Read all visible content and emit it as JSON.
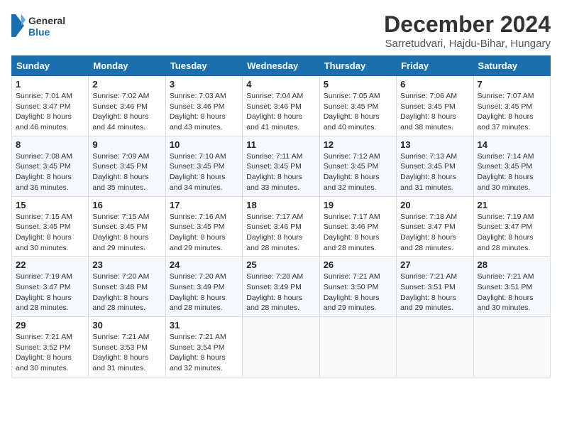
{
  "header": {
    "logo_general": "General",
    "logo_blue": "Blue",
    "month_title": "December 2024",
    "subtitle": "Sarretudvari, Hajdu-Bihar, Hungary"
  },
  "calendar": {
    "headers": [
      "Sunday",
      "Monday",
      "Tuesday",
      "Wednesday",
      "Thursday",
      "Friday",
      "Saturday"
    ],
    "weeks": [
      [
        null,
        null,
        null,
        null,
        null,
        null,
        null
      ]
    ],
    "days": {
      "1": {
        "sunrise": "7:01 AM",
        "sunset": "3:47 PM",
        "daylight": "8 hours and 46 minutes."
      },
      "2": {
        "sunrise": "7:02 AM",
        "sunset": "3:46 PM",
        "daylight": "8 hours and 44 minutes."
      },
      "3": {
        "sunrise": "7:03 AM",
        "sunset": "3:46 PM",
        "daylight": "8 hours and 43 minutes."
      },
      "4": {
        "sunrise": "7:04 AM",
        "sunset": "3:46 PM",
        "daylight": "8 hours and 41 minutes."
      },
      "5": {
        "sunrise": "7:05 AM",
        "sunset": "3:45 PM",
        "daylight": "8 hours and 40 minutes."
      },
      "6": {
        "sunrise": "7:06 AM",
        "sunset": "3:45 PM",
        "daylight": "8 hours and 38 minutes."
      },
      "7": {
        "sunrise": "7:07 AM",
        "sunset": "3:45 PM",
        "daylight": "8 hours and 37 minutes."
      },
      "8": {
        "sunrise": "7:08 AM",
        "sunset": "3:45 PM",
        "daylight": "8 hours and 36 minutes."
      },
      "9": {
        "sunrise": "7:09 AM",
        "sunset": "3:45 PM",
        "daylight": "8 hours and 35 minutes."
      },
      "10": {
        "sunrise": "7:10 AM",
        "sunset": "3:45 PM",
        "daylight": "8 hours and 34 minutes."
      },
      "11": {
        "sunrise": "7:11 AM",
        "sunset": "3:45 PM",
        "daylight": "8 hours and 33 minutes."
      },
      "12": {
        "sunrise": "7:12 AM",
        "sunset": "3:45 PM",
        "daylight": "8 hours and 32 minutes."
      },
      "13": {
        "sunrise": "7:13 AM",
        "sunset": "3:45 PM",
        "daylight": "8 hours and 31 minutes."
      },
      "14": {
        "sunrise": "7:14 AM",
        "sunset": "3:45 PM",
        "daylight": "8 hours and 30 minutes."
      },
      "15": {
        "sunrise": "7:15 AM",
        "sunset": "3:45 PM",
        "daylight": "8 hours and 30 minutes."
      },
      "16": {
        "sunrise": "7:15 AM",
        "sunset": "3:45 PM",
        "daylight": "8 hours and 29 minutes."
      },
      "17": {
        "sunrise": "7:16 AM",
        "sunset": "3:45 PM",
        "daylight": "8 hours and 29 minutes."
      },
      "18": {
        "sunrise": "7:17 AM",
        "sunset": "3:46 PM",
        "daylight": "8 hours and 28 minutes."
      },
      "19": {
        "sunrise": "7:17 AM",
        "sunset": "3:46 PM",
        "daylight": "8 hours and 28 minutes."
      },
      "20": {
        "sunrise": "7:18 AM",
        "sunset": "3:47 PM",
        "daylight": "8 hours and 28 minutes."
      },
      "21": {
        "sunrise": "7:19 AM",
        "sunset": "3:47 PM",
        "daylight": "8 hours and 28 minutes."
      },
      "22": {
        "sunrise": "7:19 AM",
        "sunset": "3:47 PM",
        "daylight": "8 hours and 28 minutes."
      },
      "23": {
        "sunrise": "7:20 AM",
        "sunset": "3:48 PM",
        "daylight": "8 hours and 28 minutes."
      },
      "24": {
        "sunrise": "7:20 AM",
        "sunset": "3:49 PM",
        "daylight": "8 hours and 28 minutes."
      },
      "25": {
        "sunrise": "7:20 AM",
        "sunset": "3:49 PM",
        "daylight": "8 hours and 28 minutes."
      },
      "26": {
        "sunrise": "7:21 AM",
        "sunset": "3:50 PM",
        "daylight": "8 hours and 29 minutes."
      },
      "27": {
        "sunrise": "7:21 AM",
        "sunset": "3:51 PM",
        "daylight": "8 hours and 29 minutes."
      },
      "28": {
        "sunrise": "7:21 AM",
        "sunset": "3:51 PM",
        "daylight": "8 hours and 30 minutes."
      },
      "29": {
        "sunrise": "7:21 AM",
        "sunset": "3:52 PM",
        "daylight": "8 hours and 30 minutes."
      },
      "30": {
        "sunrise": "7:21 AM",
        "sunset": "3:53 PM",
        "daylight": "8 hours and 31 minutes."
      },
      "31": {
        "sunrise": "7:21 AM",
        "sunset": "3:54 PM",
        "daylight": "8 hours and 32 minutes."
      }
    }
  }
}
